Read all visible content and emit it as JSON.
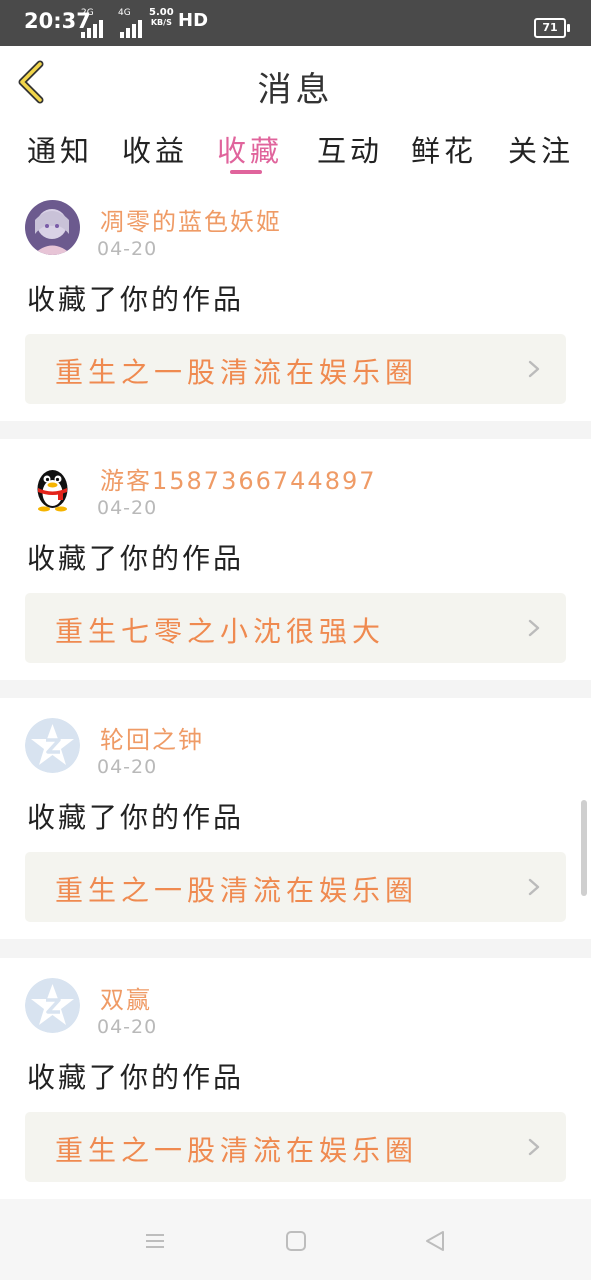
{
  "status_bar": {
    "time": "20:37",
    "signal1_label": "2G",
    "signal2_label": "4G",
    "speed_value": "5.00",
    "speed_unit": "KB/S",
    "hd_label": "HD",
    "battery": "71"
  },
  "header": {
    "title": "消息",
    "back_icon": "chevron-left-icon"
  },
  "tabs": [
    {
      "label": "通知",
      "active": false
    },
    {
      "label": "收益",
      "active": false
    },
    {
      "label": "收藏",
      "active": true
    },
    {
      "label": "互动",
      "active": false
    },
    {
      "label": "鲜花",
      "active": false
    },
    {
      "label": "关注",
      "active": false
    }
  ],
  "colors": {
    "accent": "#e0649c",
    "username": "#ef9b66",
    "work_title": "#ef8a50"
  },
  "messages": [
    {
      "username": "凋零的蓝色妖姬",
      "date": "04-20",
      "action": "收藏了你的作品",
      "work_title": "重生之一股清流在娱乐圈",
      "avatar": "anime-girl-avatar"
    },
    {
      "username": "游客1587366744897",
      "date": "04-20",
      "action": "收藏了你的作品",
      "work_title": "重生七零之小沈很强大",
      "avatar": "penguin-avatar"
    },
    {
      "username": "轮回之钟",
      "date": "04-20",
      "action": "收藏了你的作品",
      "work_title": "重生之一股清流在娱乐圈",
      "avatar": "default-star-avatar"
    },
    {
      "username": "双赢",
      "date": "04-20",
      "action": "收藏了你的作品",
      "work_title": "重生之一股清流在娱乐圈",
      "avatar": "default-star-avatar"
    }
  ],
  "nav_bar": [
    "menu-icon",
    "home-icon",
    "back-triangle-icon"
  ]
}
